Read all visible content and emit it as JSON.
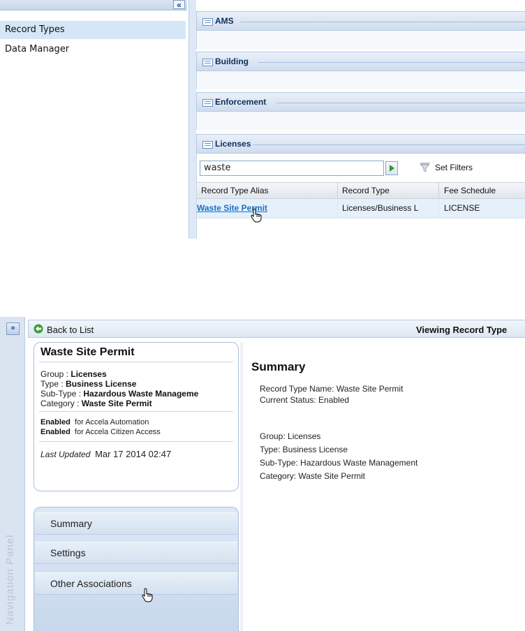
{
  "top": {
    "collapse_glyph": "«",
    "left_panel": {
      "items": [
        {
          "label": "Record Types",
          "selected": true
        },
        {
          "label": "Data Manager",
          "selected": false
        }
      ]
    },
    "groups": [
      {
        "label": "AMS"
      },
      {
        "label": "Building"
      },
      {
        "label": "Enforcement"
      },
      {
        "label": "Licenses"
      }
    ],
    "search": {
      "value": "waste"
    },
    "go_icon": "play-arrow-icon",
    "set_filters_label": "Set Filters",
    "filter_icon": "funnel-icon",
    "grid": {
      "columns": [
        "Record Type Alias",
        "Record Type",
        "Fee Schedule"
      ],
      "rows": [
        {
          "alias": "Waste Site Permit",
          "record_type": "Licenses/Business L",
          "fee_schedule": "LICENSE"
        }
      ]
    }
  },
  "bottom": {
    "expand_glyph": "»",
    "nav_panel_label": "Navigation Panel",
    "toolbar": {
      "back_label": "Back to List",
      "back_icon": "back-arrow-icon",
      "viewing_label": "Viewing Record Type"
    },
    "card": {
      "title": "Waste Site Permit",
      "group_key": "Group :",
      "group_val": "Licenses",
      "type_key": "Type :",
      "type_val": "Business License",
      "subtype_key": "Sub-Type :",
      "subtype_val": "Hazardous Waste Manageme",
      "category_key": "Category :",
      "category_val": "Waste Site Permit",
      "enabled1_key": "Enabled",
      "enabled1_val": "for Accela Automation",
      "enabled2_key": "Enabled",
      "enabled2_val": "for Accela Citizen Access",
      "updated_key": "Last Updated",
      "updated_val": "Mar 17 2014 02:47"
    },
    "nav_items": [
      {
        "label": "Summary"
      },
      {
        "label": "Settings"
      },
      {
        "label": "Other Associations"
      }
    ],
    "summary": {
      "title": "Summary",
      "lines": [
        "Record Type Name:  Waste Site Permit",
        "Current Status:  Enabled",
        "Group:  Licenses",
        "Type:  Business License",
        "Sub-Type:  Hazardous Waste Management",
        "Category:  Waste Site Permit"
      ]
    }
  },
  "colors": {
    "accent_blue": "#15428b",
    "panel_blue": "#dae4f1",
    "selected_row": "#d5e6f6",
    "link": "#1a6fc4",
    "go_green": "#2f9a2f"
  }
}
